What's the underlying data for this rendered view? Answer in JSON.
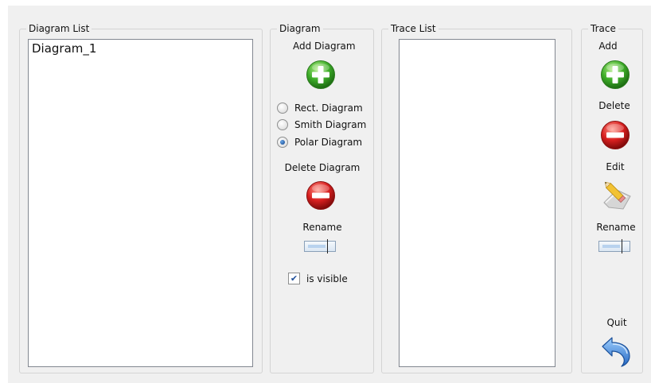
{
  "groups": {
    "diagram_list": {
      "title": "Diagram List",
      "items": [
        "Diagram_1"
      ]
    },
    "diagram": {
      "title": "Diagram",
      "add_label": "Add Diagram",
      "radio_options": [
        "Rect. Diagram",
        "Smith Diagram",
        "Polar Diagram"
      ],
      "selected_option": "Polar Diagram",
      "delete_label": "Delete Diagram",
      "rename_label": "Rename",
      "visible_label": "is visible",
      "visible_checked": true
    },
    "trace_list": {
      "title": "Trace List",
      "items": []
    },
    "trace": {
      "title": "Trace",
      "add_label": "Add",
      "delete_label": "Delete",
      "edit_label": "Edit",
      "rename_label": "Rename",
      "quit_label": "Quit"
    }
  },
  "icons": {
    "add": "plus-circle-icon",
    "delete": "minus-circle-icon",
    "edit": "pencil-icon",
    "quit": "undo-arrow-icon"
  },
  "colors": {
    "add_green": "#3fae2a",
    "delete_red": "#d92020",
    "quit_blue": "#3d86d8",
    "radio_selected": "#0b3f86"
  }
}
